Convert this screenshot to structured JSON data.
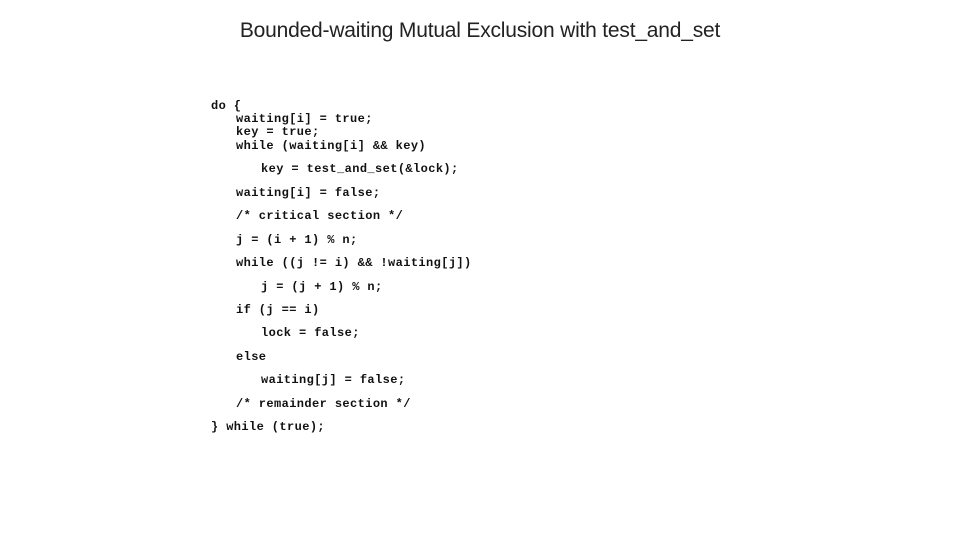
{
  "slide": {
    "title": "Bounded-waiting Mutual Exclusion with test_and_set",
    "code_lines": [
      {
        "indent": 0,
        "text": "do {"
      },
      {
        "indent": 1,
        "text": "waiting[i] = true;"
      },
      {
        "indent": 1,
        "text": "key = true;"
      },
      {
        "indent": 1,
        "text": "while (waiting[i] && key)"
      },
      {
        "indent": 2,
        "text": "key = test_and_set(&lock);"
      },
      {
        "indent": 1,
        "text": "waiting[i] = false;"
      },
      {
        "indent": 1,
        "text": "/* critical section */"
      },
      {
        "indent": 1,
        "text": "j = (i + 1) % n;"
      },
      {
        "indent": 1,
        "text": "while ((j != i) && !waiting[j])"
      },
      {
        "indent": 2,
        "text": "j = (j + 1) % n;"
      },
      {
        "indent": 1,
        "text": "if (j == i)"
      },
      {
        "indent": 2,
        "text": "lock = false;"
      },
      {
        "indent": 1,
        "text": "else"
      },
      {
        "indent": 2,
        "text": "waiting[j] = false;"
      },
      {
        "indent": 1,
        "text": "/* remainder section */"
      },
      {
        "indent": 0,
        "text": "} while (true);"
      }
    ]
  }
}
